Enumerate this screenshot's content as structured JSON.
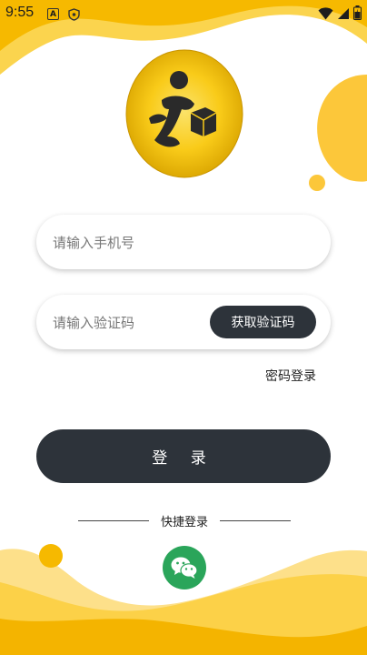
{
  "status_bar": {
    "time": "9:55",
    "notification_icon_a": "A"
  },
  "login_form": {
    "phone_placeholder": "请输入手机号",
    "code_placeholder": "请输入验证码",
    "get_code_label": "获取验证码",
    "password_login_label": "密码登录",
    "login_label": "登 录"
  },
  "quick_login": {
    "label": "快捷登录"
  },
  "icons": {
    "logo": "courier-logo-icon",
    "wechat": "wechat-icon",
    "wifi": "wifi-icon",
    "signal": "signal-icon",
    "battery": "battery-icon"
  },
  "colors": {
    "accent_yellow": "#f9c410",
    "dark_button": "#2d333a",
    "wechat_green": "#2aa55a"
  }
}
